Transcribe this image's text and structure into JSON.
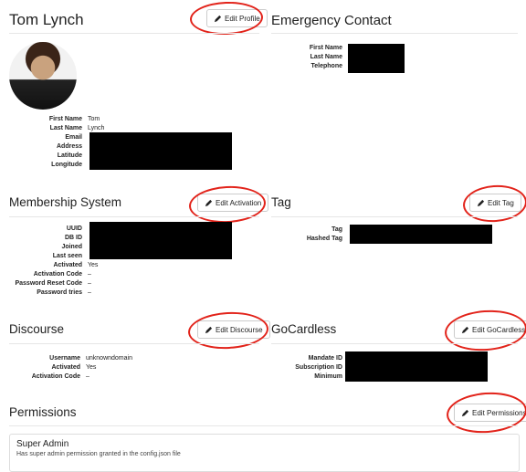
{
  "profile": {
    "name": "Tom Lynch",
    "edit_label": "Edit Profile",
    "fields": [
      {
        "k": "First Name",
        "v": "Tom"
      },
      {
        "k": "Last Name",
        "v": "Lynch"
      },
      {
        "k": "Email",
        "v": ""
      },
      {
        "k": "Address",
        "v": ""
      },
      {
        "k": "Latitude",
        "v": ""
      },
      {
        "k": "Longitude",
        "v": ""
      }
    ]
  },
  "emergency": {
    "title": "Emergency Contact",
    "fields": [
      {
        "k": "First Name",
        "v": ""
      },
      {
        "k": "Last Name",
        "v": ""
      },
      {
        "k": "Telephone",
        "v": ""
      }
    ]
  },
  "membership": {
    "title": "Membership System",
    "edit_label": "Edit Activation",
    "fields": [
      {
        "k": "UUID",
        "v": ""
      },
      {
        "k": "DB ID",
        "v": ""
      },
      {
        "k": "Joined",
        "v": ""
      },
      {
        "k": "Last seen",
        "v": ""
      },
      {
        "k": "Activated",
        "v": "Yes"
      },
      {
        "k": "Activation Code",
        "v": "–"
      },
      {
        "k": "Password Reset Code",
        "v": "–"
      },
      {
        "k": "Password tries",
        "v": "–"
      }
    ]
  },
  "tag": {
    "title": "Tag",
    "edit_label": "Edit Tag",
    "fields": [
      {
        "k": "Tag",
        "v": ""
      },
      {
        "k": "Hashed Tag",
        "v": ""
      }
    ]
  },
  "discourse": {
    "title": "Discourse",
    "edit_label": "Edit Discourse",
    "fields": [
      {
        "k": "Username",
        "v": "unknowndomain"
      },
      {
        "k": "Activated",
        "v": "Yes"
      },
      {
        "k": "Activation Code",
        "v": "–"
      }
    ]
  },
  "gocardless": {
    "title": "GoCardless",
    "edit_label": "Edit GoCardless",
    "fields": [
      {
        "k": "Mandate ID",
        "v": ""
      },
      {
        "k": "Subscription ID",
        "v": ""
      },
      {
        "k": "Minimum",
        "v": ""
      }
    ]
  },
  "permissions": {
    "title": "Permissions",
    "edit_label": "Edit Permissions",
    "card_title": "Super Admin",
    "card_text": "Has super admin permission granted in the config.json file"
  },
  "colors": {
    "annotation_red": "#e2231a",
    "redaction": "#000000"
  },
  "icons": {
    "edit": "pencil-icon"
  }
}
